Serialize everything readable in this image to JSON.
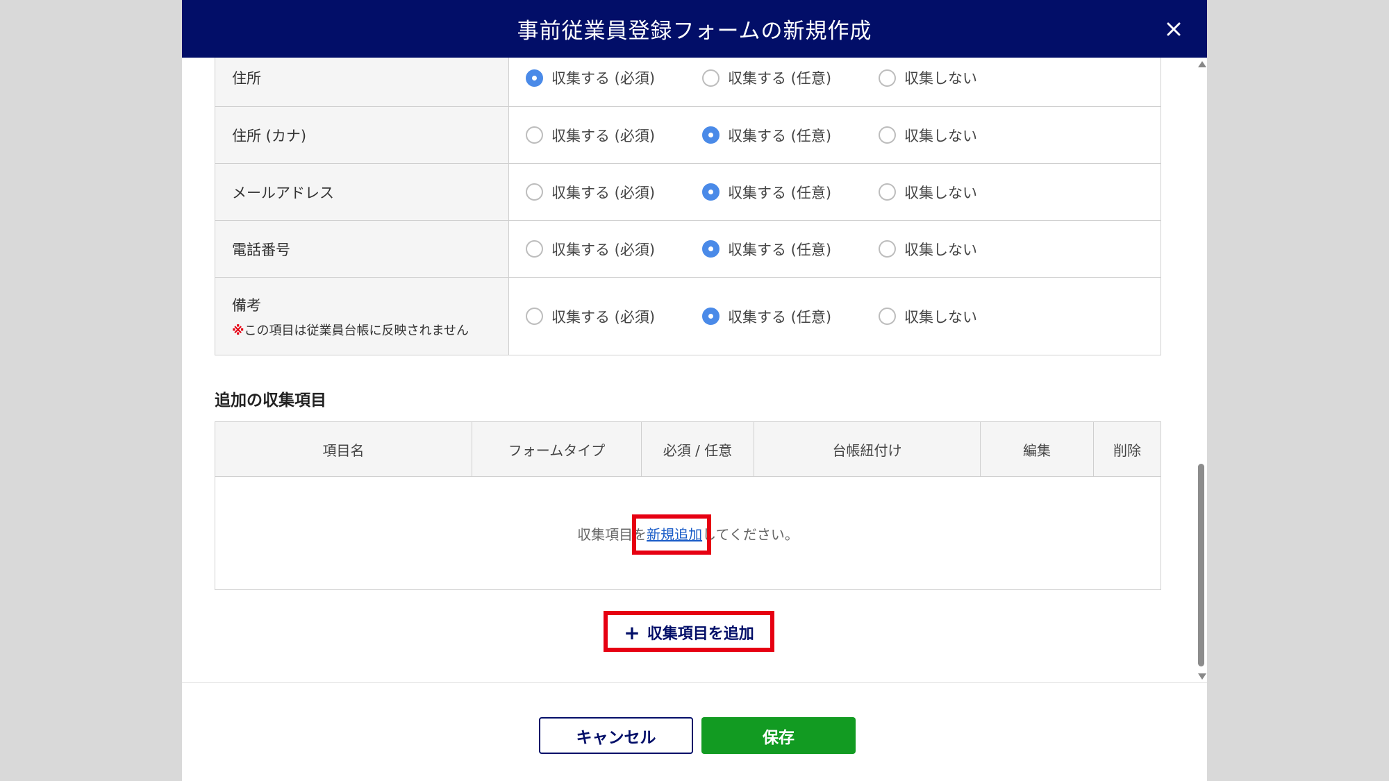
{
  "modal": {
    "title": "事前従業員登録フォームの新規作成"
  },
  "fields": [
    {
      "name": "住所",
      "note": "",
      "selected": 0
    },
    {
      "name": "住所 (カナ)",
      "note": "",
      "selected": 1
    },
    {
      "name": "メールアドレス",
      "note": "",
      "selected": 1
    },
    {
      "name": "電話番号",
      "note": "",
      "selected": 1
    },
    {
      "name": "備考",
      "note_mark": "※",
      "note": "この項目は従業員台帳に反映されません",
      "selected": 1
    }
  ],
  "options": [
    "収集する (必須)",
    "収集する (任意)",
    "収集しない"
  ],
  "extra": {
    "title": "追加の収集項目",
    "columns": [
      "項目名",
      "フォームタイプ",
      "必須 / 任意",
      "台帳紐付け",
      "編集",
      "削除"
    ],
    "empty_prefix": "収集項目を",
    "empty_link": "新規追加",
    "empty_suffix": "してください。",
    "add_label": "収集項目を追加"
  },
  "footer": {
    "cancel_label": "キャンセル",
    "save_label": "保存"
  },
  "colors": {
    "header": "#020e68",
    "radio_selected": "#4a8ae8",
    "save": "#129b22",
    "highlight": "#e60012",
    "link": "#1a5cc8"
  },
  "icons": {
    "close": "close-icon",
    "add": "plus-icon"
  }
}
